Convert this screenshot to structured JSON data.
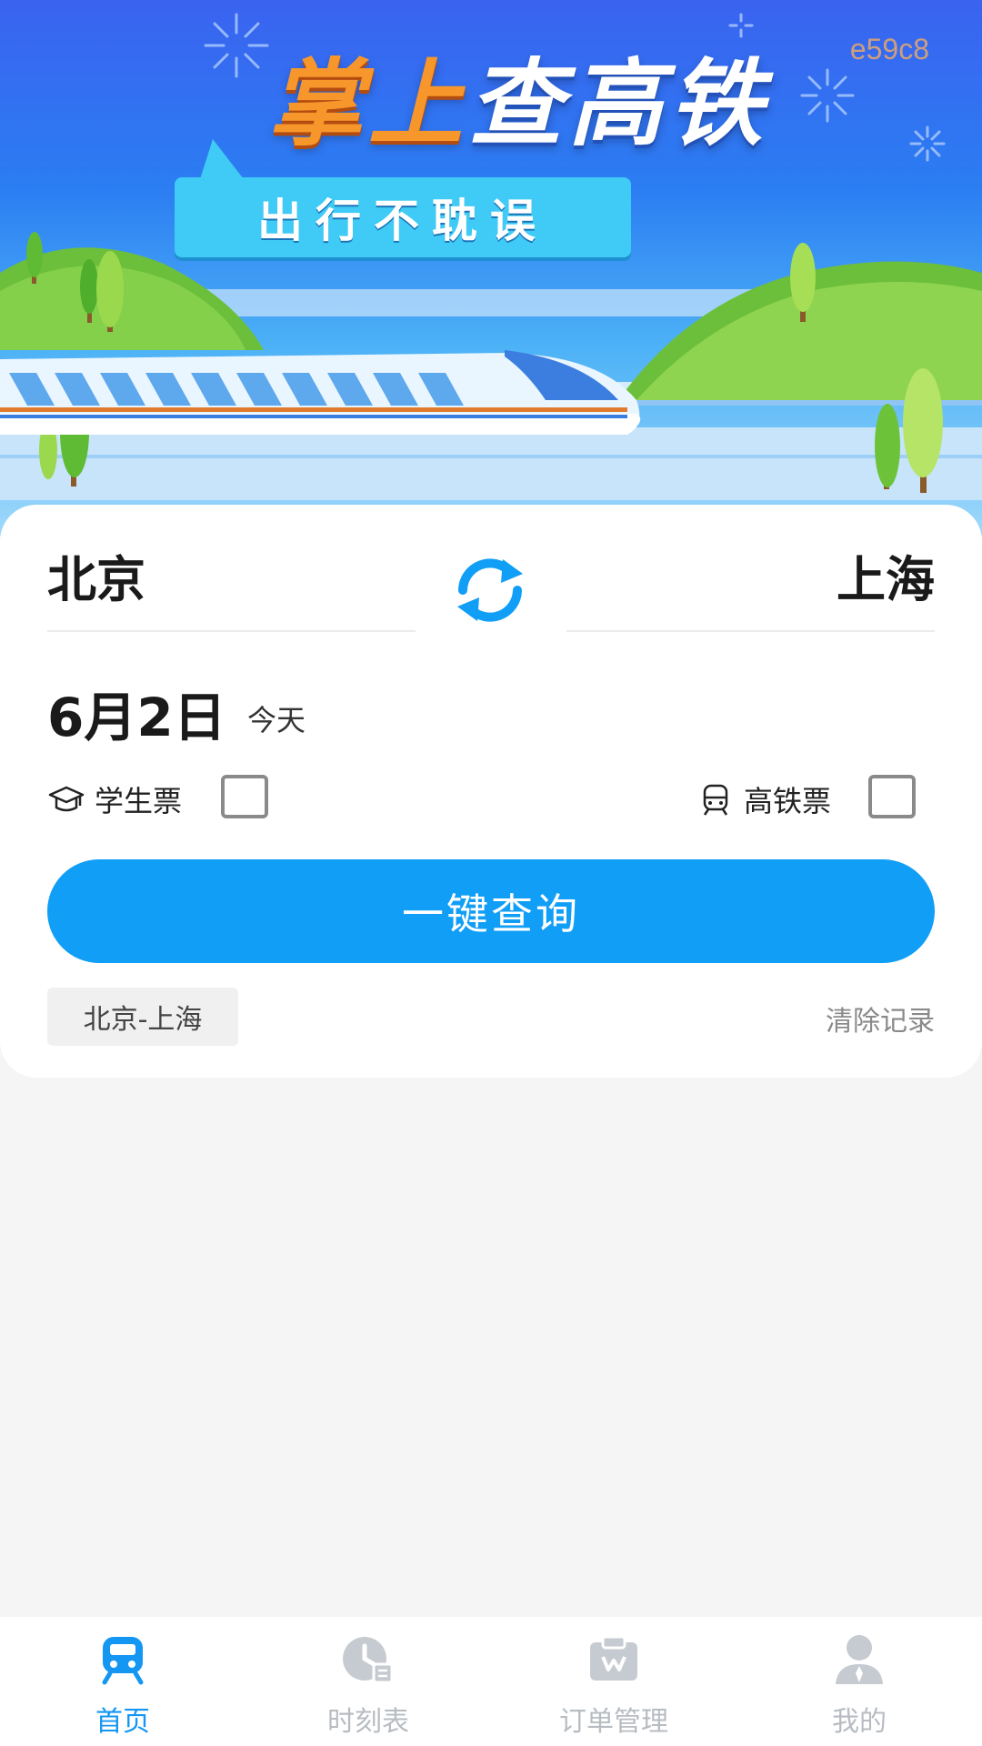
{
  "banner": {
    "code": "e59c8",
    "title_part1": "掌上",
    "title_part2": "查高铁",
    "subtitle": "出行不耽误"
  },
  "search": {
    "from_station": "北京",
    "to_station": "上海",
    "date": "6月2日",
    "date_note": "今天",
    "options": [
      {
        "label": "学生票",
        "checked": false,
        "icon": "graduation-cap-icon"
      },
      {
        "label": "高铁票",
        "checked": false,
        "icon": "train-icon"
      }
    ],
    "query_button": "一键查询",
    "history": [
      "北京-上海"
    ],
    "clear_history": "清除记录"
  },
  "bottom_nav": [
    {
      "label": "首页",
      "icon": "train-front-icon",
      "active": true
    },
    {
      "label": "时刻表",
      "icon": "clock-schedule-icon",
      "active": false
    },
    {
      "label": "订单管理",
      "icon": "orders-box-icon",
      "active": false
    },
    {
      "label": "我的",
      "icon": "user-profile-icon",
      "active": false
    }
  ],
  "colors": {
    "accent": "#109ef6",
    "nav_active": "#1496f3",
    "nav_inactive": "#b7bcc2",
    "title_orange": "#f7962b"
  }
}
